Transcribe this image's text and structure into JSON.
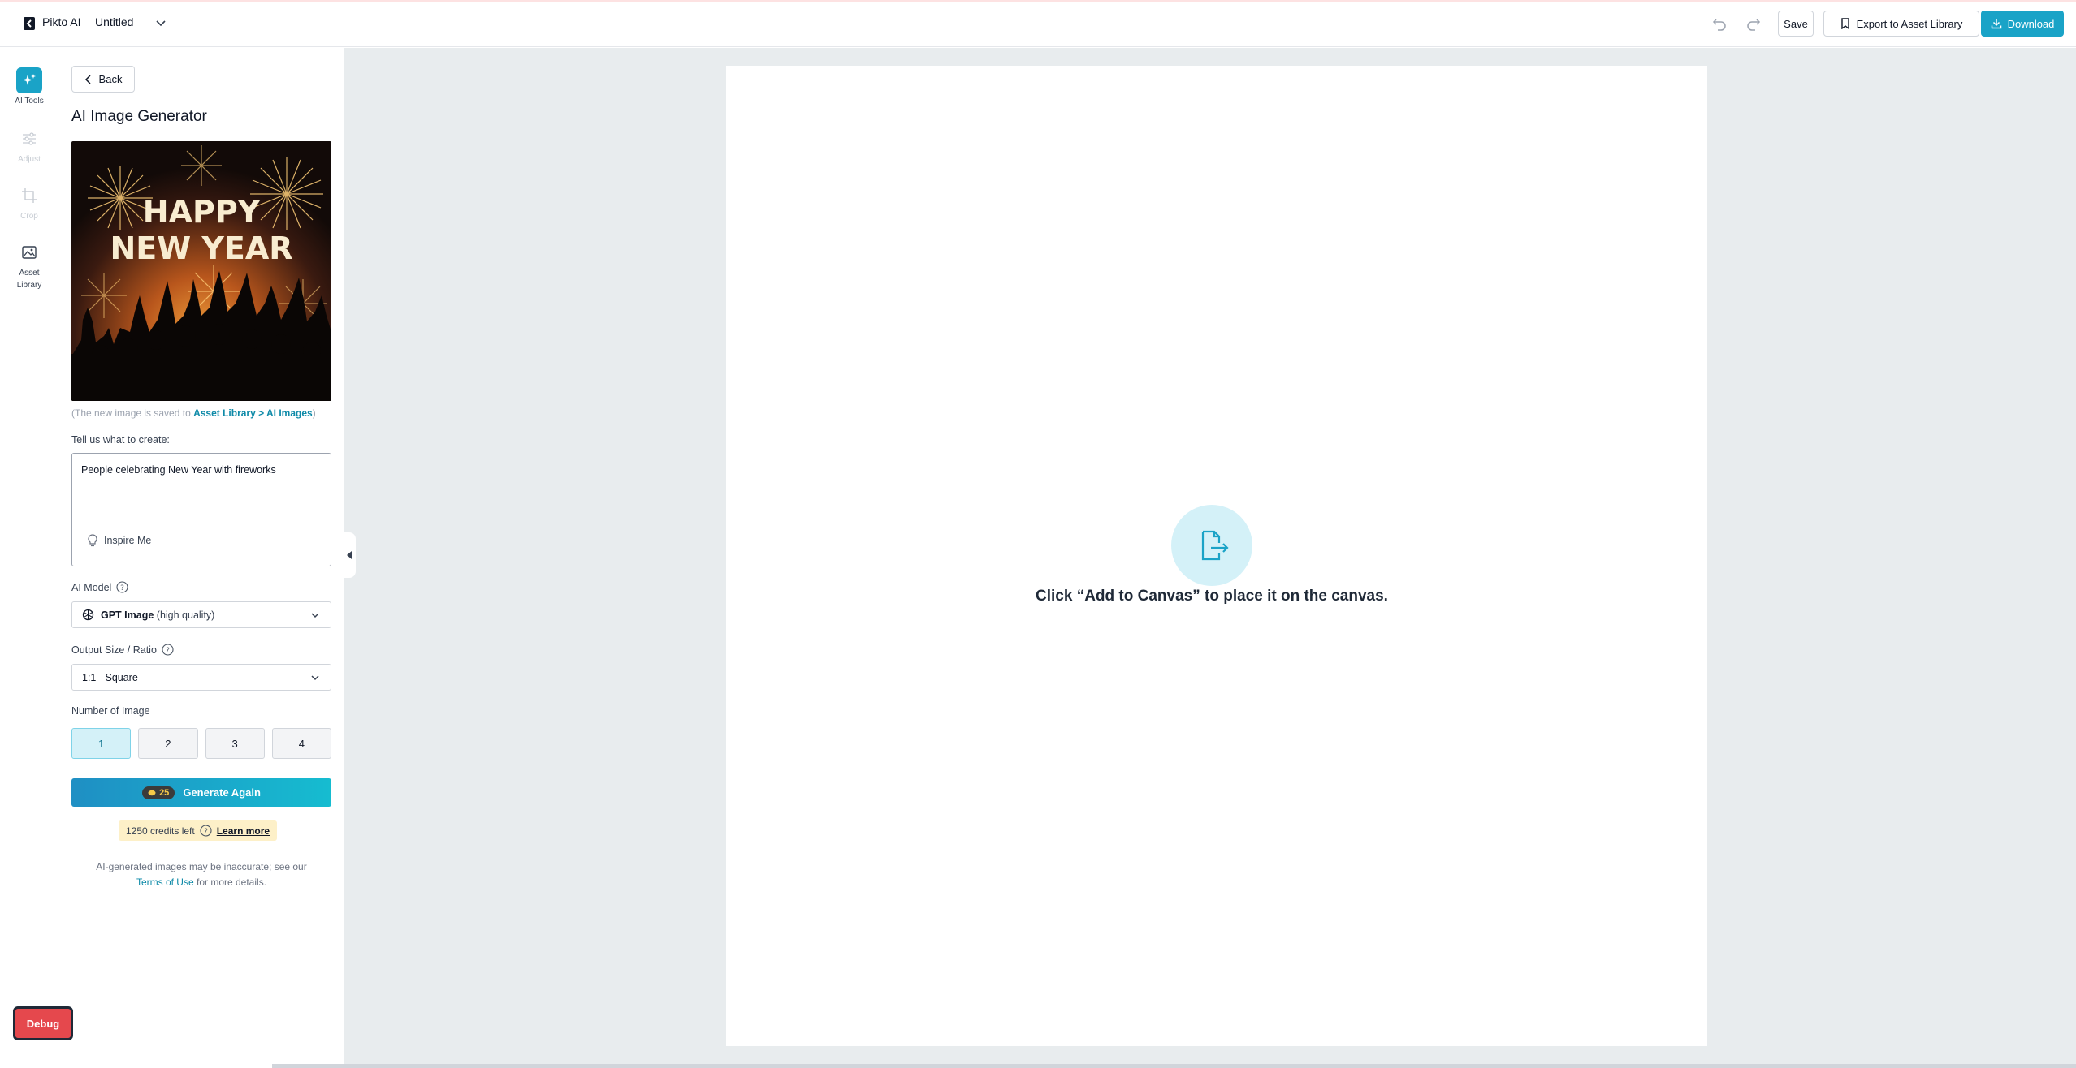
{
  "header": {
    "app_name": "Pikto AI",
    "doc_title": "Untitled",
    "save_label": "Save",
    "export_label": "Export to Asset Library",
    "download_label": "Download"
  },
  "rail": {
    "items": [
      {
        "label": "AI Tools",
        "icon": "sparkle-icon",
        "state": "active"
      },
      {
        "label": "Adjust",
        "icon": "sliders-icon",
        "state": "disabled"
      },
      {
        "label": "Crop",
        "icon": "crop-icon",
        "state": "disabled"
      },
      {
        "label": "Asset Library",
        "icon": "image-icon",
        "state": "normal"
      }
    ]
  },
  "panel": {
    "back_label": "Back",
    "title": "AI Image Generator",
    "image_text_line1": "HAPPY",
    "image_text_line2": "NEW YEAR",
    "saved_note_prefix": "(The new image is saved to ",
    "saved_note_link": "Asset Library > AI Images",
    "saved_note_suffix": ")",
    "prompt_label": "Tell us what to create:",
    "prompt_value": "People celebrating New Year with fireworks",
    "inspire_label": "Inspire Me",
    "model_label": "AI Model",
    "model_value": "GPT Image",
    "model_quality": "(high quality)",
    "size_label": "Output Size / Ratio",
    "size_value": "1:1 - Square",
    "num_label": "Number of Image",
    "num_options": [
      "1",
      "2",
      "3",
      "4"
    ],
    "num_selected": "1",
    "generate_cost": "25",
    "generate_label": "Generate Again",
    "credits_text": "1250 credits left",
    "learn_more": "Learn more",
    "disclaimer_line1": "AI-generated images may be inaccurate; see our",
    "terms_link": "Terms of Use",
    "disclaimer_line2": " for more details."
  },
  "canvas": {
    "message": "Click “Add to Canvas” to place it on the canvas."
  },
  "debug_label": "Debug",
  "colors": {
    "accent": "#1aa3c7",
    "canvas_bg": "#e8ecee",
    "selected_num_bg": "#d4f1f8",
    "credits_bg": "#fdf0c8",
    "debug_bg": "#e5484d"
  }
}
